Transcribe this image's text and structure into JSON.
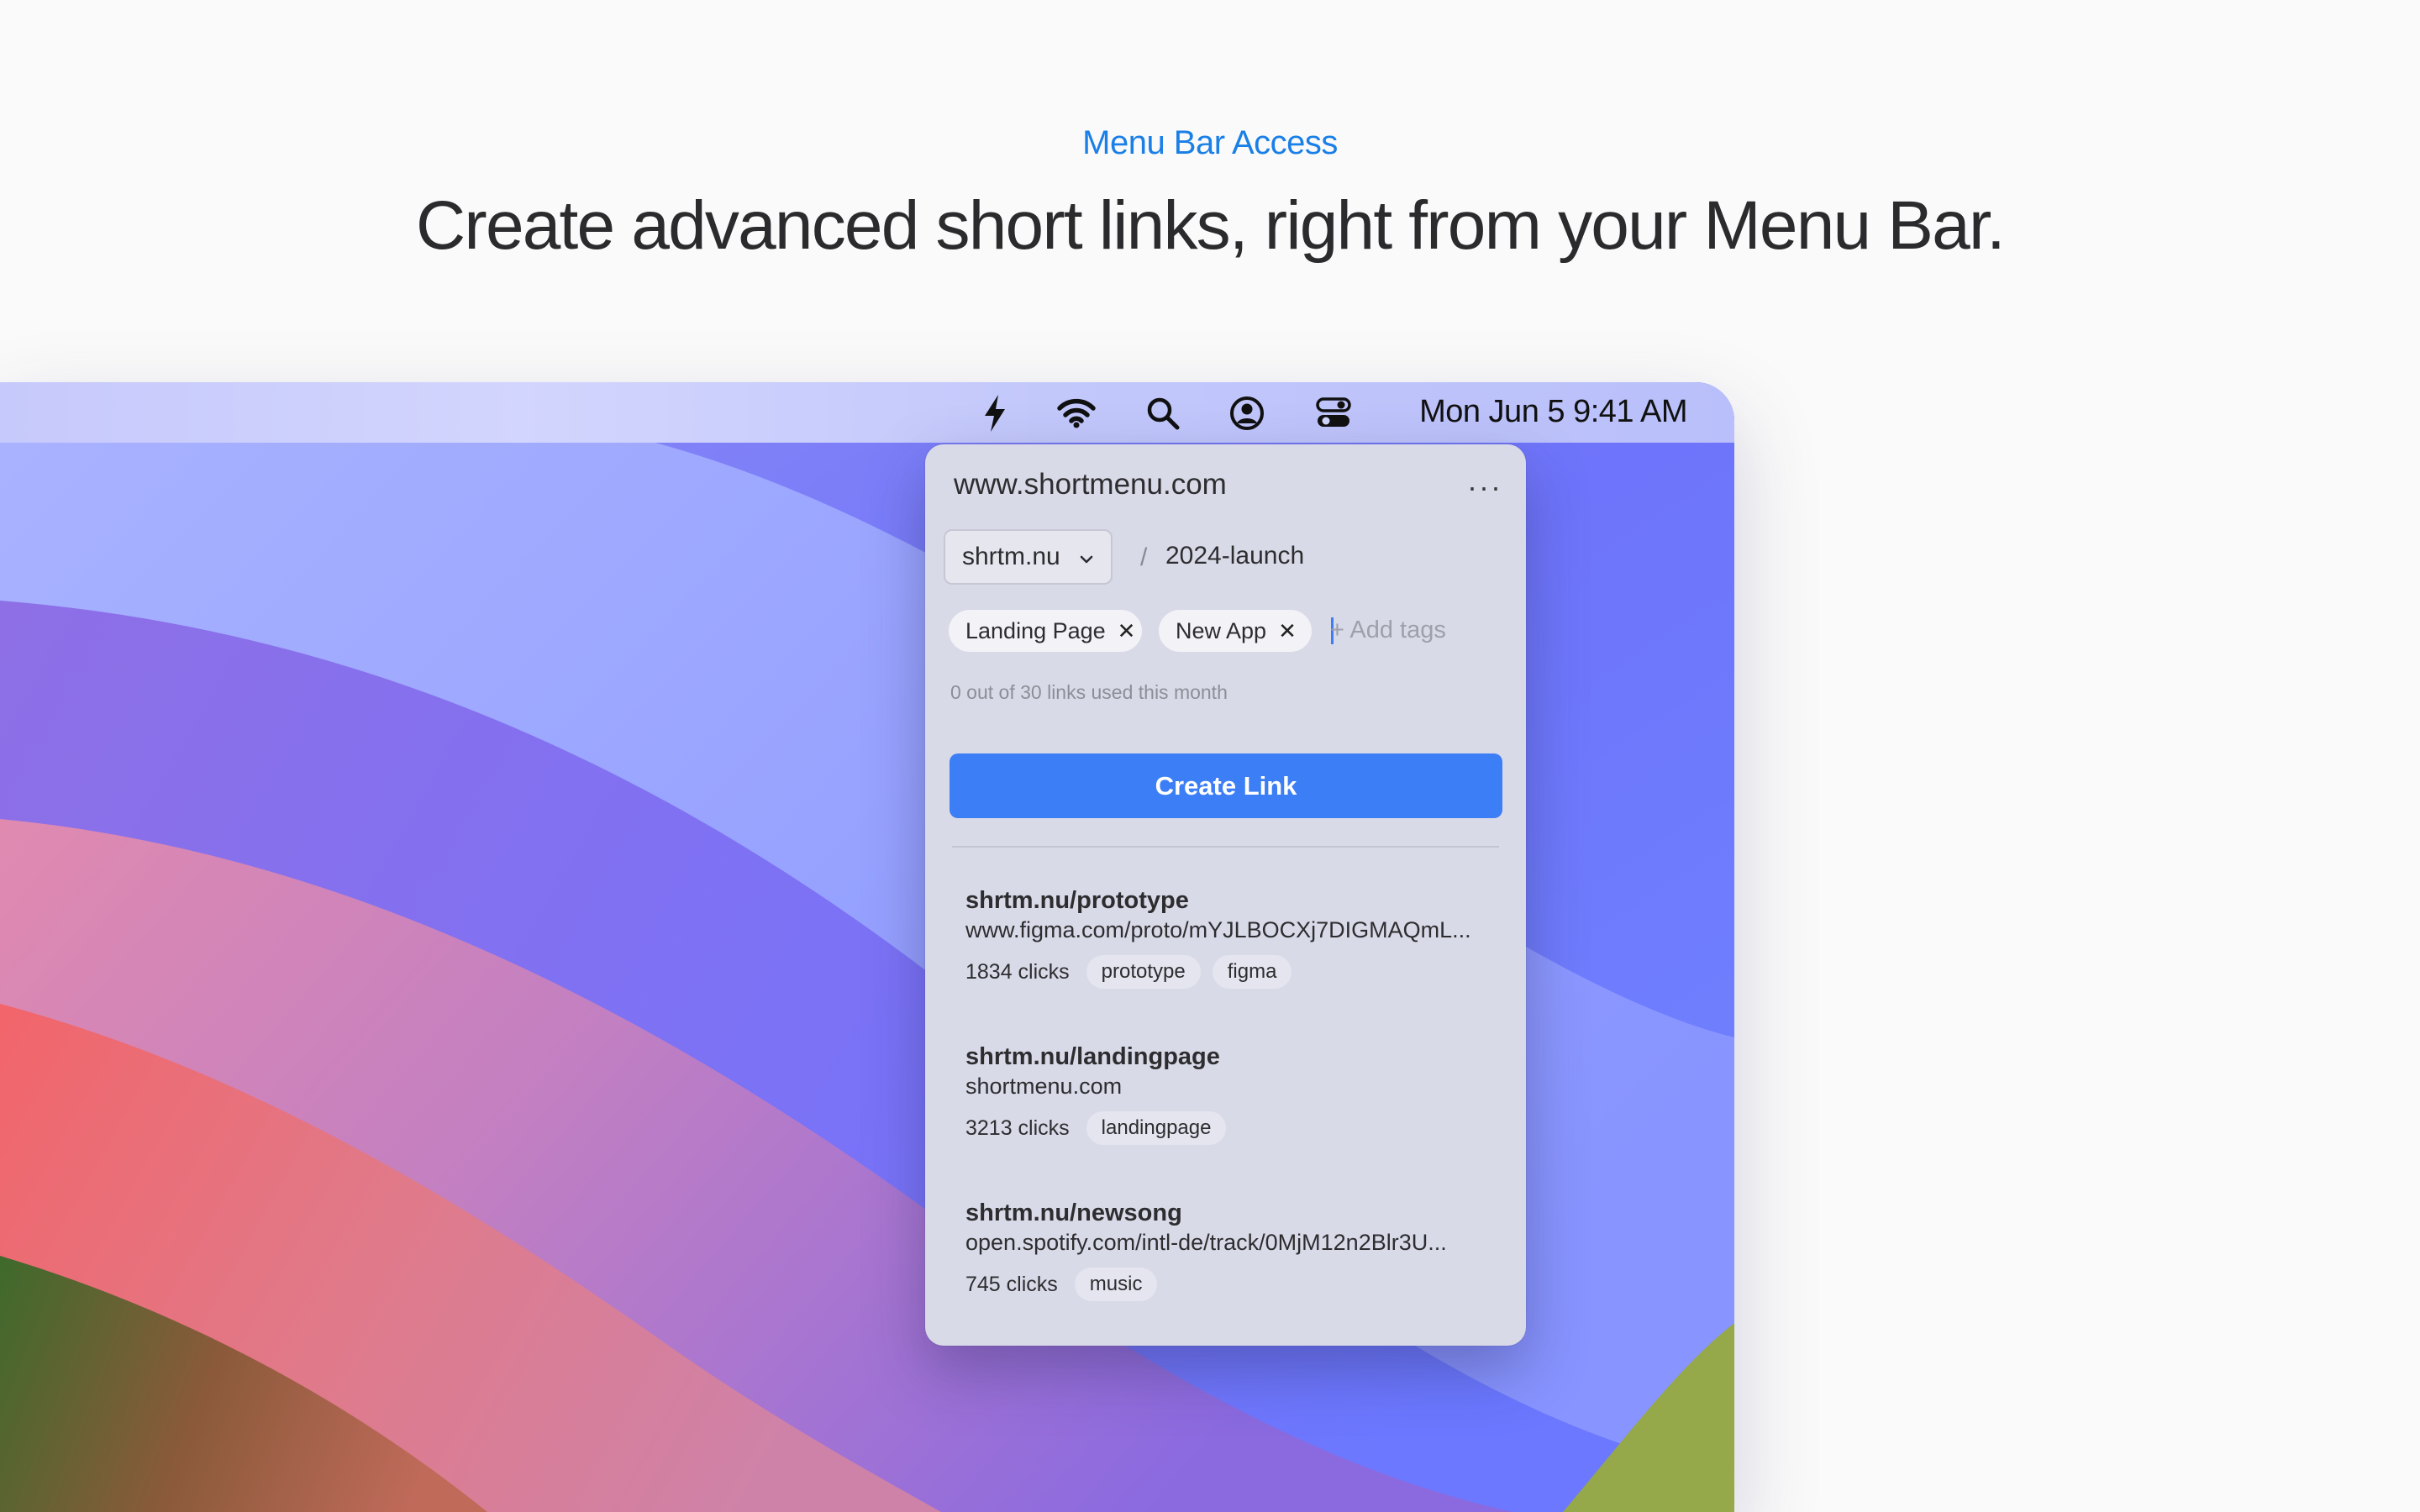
{
  "page": {
    "eyebrow": "Menu Bar Access",
    "headline": "Create advanced short links, right from your Menu Bar."
  },
  "menubar": {
    "icons": [
      "bolt-icon",
      "wifi-icon",
      "search-icon",
      "user-circle-icon",
      "control-center-icon"
    ],
    "clock": "Mon Jun 5  9:41 AM"
  },
  "popover": {
    "url": "www.shortmenu.com",
    "more_label": "···",
    "domain": "shrtm.nu",
    "separator": "/",
    "slug": "2024-launch",
    "tags": [
      {
        "label": "Landing Page",
        "remove": "✕"
      },
      {
        "label": "New App",
        "remove": "✕"
      }
    ],
    "add_tags_placeholder": "+ Add tags",
    "usage": "0 out of 30 links used this month",
    "create_label": "Create Link",
    "links": [
      {
        "short": "shrtm.nu/prototype",
        "dest": "www.figma.com/proto/mYJLBOCXj7DIGMAQmL...",
        "clicks": "1834 clicks",
        "tags": [
          "prototype",
          "figma"
        ]
      },
      {
        "short": "shrtm.nu/landingpage",
        "dest": "shortmenu.com",
        "clicks": "3213 clicks",
        "tags": [
          "landingpage"
        ]
      },
      {
        "short": "shrtm.nu/newsong",
        "dest": "open.spotify.com/intl-de/track/0MjM12n2Blr3U...",
        "clicks": "745 clicks",
        "tags": [
          "music"
        ]
      }
    ]
  },
  "colors": {
    "accent": "#3c7ef5",
    "eyebrow": "#1a7fe6",
    "headline": "#2b2b2d",
    "popover_bg": "#d9dae8"
  }
}
